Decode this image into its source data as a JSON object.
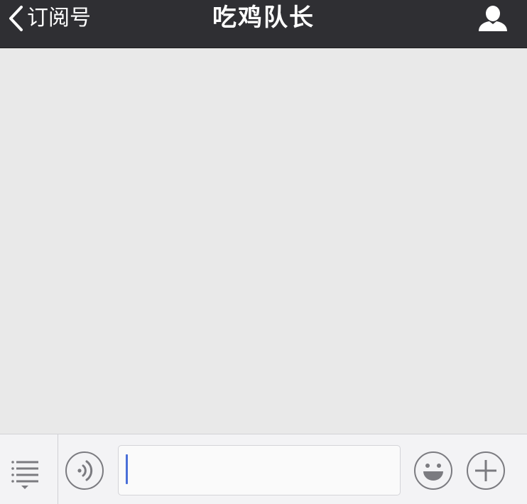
{
  "header": {
    "back_label": "订阅号",
    "title": "吃鸡队长",
    "back_icon": "chevron-left-icon",
    "profile_icon": "person-icon"
  },
  "input_bar": {
    "menu_icon": "menu-list-icon",
    "voice_icon": "voice-icon",
    "text_value": "",
    "emoji_icon": "emoji-icon",
    "plus_icon": "plus-icon"
  },
  "colors": {
    "header_bg": "#2f2f33",
    "chat_bg": "#e9e9e9",
    "bar_bg": "#f3f3f5",
    "caret": "#4a6fd8"
  }
}
